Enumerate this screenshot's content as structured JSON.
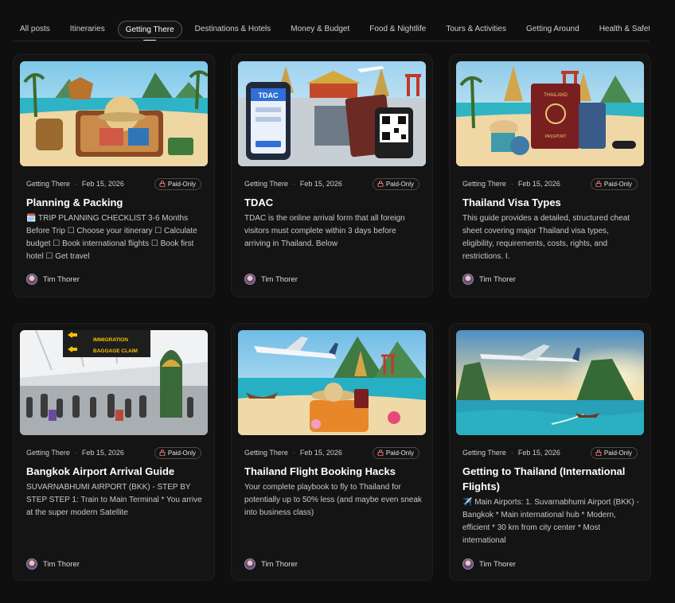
{
  "tabs": [
    {
      "label": "All posts",
      "active": false
    },
    {
      "label": "Itineraries",
      "active": false
    },
    {
      "label": "Getting There",
      "active": true
    },
    {
      "label": "Destinations & Hotels",
      "active": false
    },
    {
      "label": "Money & Budget",
      "active": false
    },
    {
      "label": "Food & Nightlife",
      "active": false
    },
    {
      "label": "Tours & Activities",
      "active": false
    },
    {
      "label": "Getting Around",
      "active": false
    },
    {
      "label": "Health & Safety",
      "active": false
    }
  ],
  "cards": [
    {
      "category": "Getting There",
      "date": "Feb 15, 2026",
      "badge": "Paid-Only",
      "title": "Planning & Packing",
      "excerpt": "🗓️ TRIP PLANNING CHECKLIST 3-6 Months Before Trip ☐ Choose your itinerary ☐ Calculate budget ☐ Book international flights ☐ Book first hotel ☐ Get travel",
      "author": "Tim Thorer"
    },
    {
      "category": "Getting There",
      "date": "Feb 15, 2026",
      "badge": "Paid-Only",
      "title": "TDAC",
      "excerpt": "TDAC is the online arrival form that all foreign visitors must complete within 3 days before arriving in Thailand. Below",
      "author": "Tim Thorer"
    },
    {
      "category": "Getting There",
      "date": "Feb 15, 2026",
      "badge": "Paid-Only",
      "title": "Thailand Visa Types",
      "excerpt": "This guide provides a detailed, structured cheat sheet covering major Thailand visa types, eligibility, requirements, costs, rights, and restrictions. I.",
      "author": "Tim Thorer"
    },
    {
      "category": "Getting There",
      "date": "Feb 15, 2026",
      "badge": "Paid-Only",
      "title": "Bangkok Airport Arrival Guide",
      "excerpt": "SUVARNABHUMI AIRPORT (BKK) - STEP BY STEP STEP 1: Train to Main Terminal * You arrive at the super modern Satellite",
      "author": "Tim Thorer"
    },
    {
      "category": "Getting There",
      "date": "Feb 15, 2026",
      "badge": "Paid-Only",
      "title": "Thailand Flight Booking Hacks",
      "excerpt": "Your complete playbook to fly to Thailand for potentially up to 50% less (and maybe even sneak into business class)",
      "author": "Tim Thorer"
    },
    {
      "category": "Getting There",
      "date": "Feb 15, 2026",
      "badge": "Paid-Only",
      "title": "Getting to Thailand (International Flights)",
      "excerpt": "✈️ Main Airports: 1. Suvarnabhumi Airport (BKK) - Bangkok * Main international hub * Modern, efficient * 30 km from city center * Most international",
      "author": "Tim Thorer"
    }
  ],
  "image_text": {
    "tdac_phone": "TDAC",
    "visa_passport": "THAILAND",
    "passport_label": "PASSPORT",
    "airport_sign_1": "IMMIGRATION",
    "airport_sign_2": "BAGGAGE CLAIM"
  }
}
